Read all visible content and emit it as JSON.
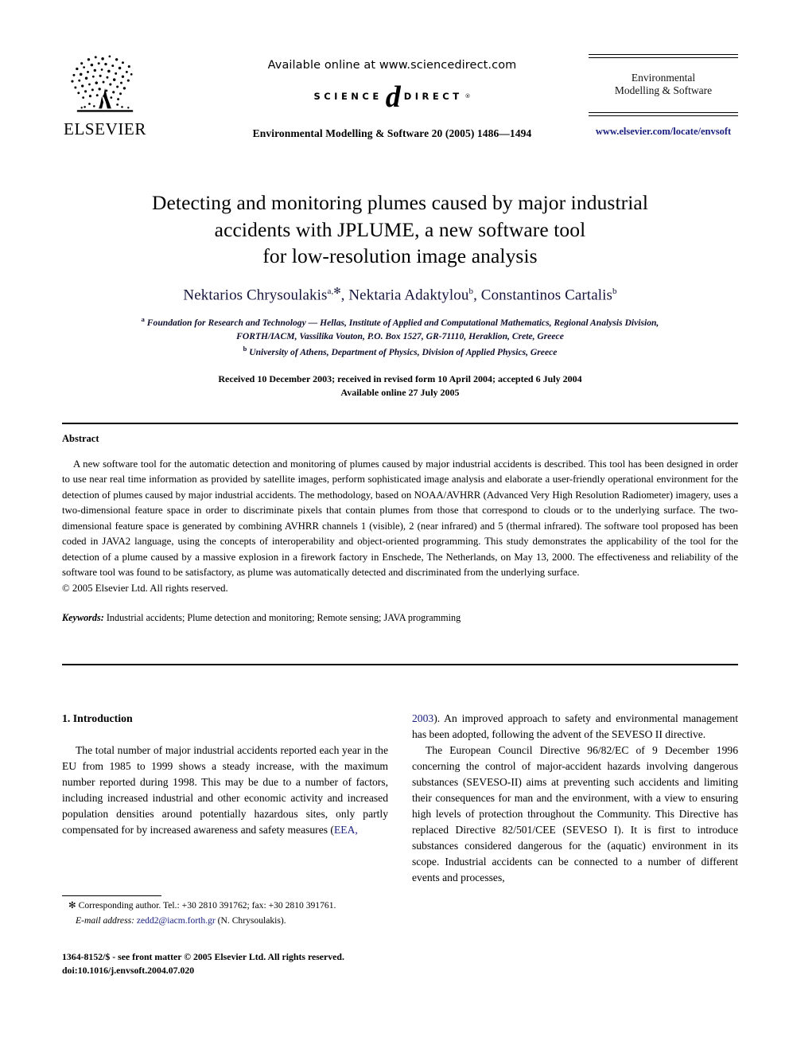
{
  "masthead": {
    "publisher_name": "ELSEVIER",
    "available_online": "Available online at www.sciencedirect.com",
    "sciencedirect": {
      "word_left": "SCIENCE",
      "at_glyph": "d",
      "word_right": "DIRECT",
      "trademark": "®"
    },
    "journal_reference": "Environmental Modelling & Software 20 (2005) 1486—1494",
    "journal_name_line1": "Environmental",
    "journal_name_line2": "Modelling & Software",
    "journal_url": "www.elsevier.com/locate/envsoft"
  },
  "article": {
    "title_line1": "Detecting and monitoring plumes caused by major industrial",
    "title_line2": "accidents with JPLUME, a new software tool",
    "title_line3": "for low-resolution image analysis",
    "authors": [
      {
        "name": "Nektarios Chrysoulakis",
        "marks": "a,✻"
      },
      {
        "name": "Nektaria Adaktylou",
        "marks": "b"
      },
      {
        "name": "Constantinos Cartalis",
        "marks": "b"
      }
    ],
    "affiliation_a_line1": "Foundation for Research and Technology — Hellas, Institute of Applied and Computational Mathematics, Regional Analysis Division,",
    "affiliation_a_line2": "FORTH/IACM, Vassilika Vouton, P.O. Box 1527, GR-71110, Heraklion, Crete, Greece",
    "affiliation_b": "University of Athens, Department of Physics, Division of Applied Physics, Greece",
    "affiliation_a_mark": "a",
    "affiliation_b_mark": "b",
    "received_line": "Received 10 December 2003; received in revised form 10 April 2004; accepted 6 July 2004",
    "available_line": "Available online 27 July 2005"
  },
  "abstract": {
    "heading": "Abstract",
    "text": "A new software tool for the automatic detection and monitoring of plumes caused by major industrial accidents is described. This tool has been designed in order to use near real time information as provided by satellite images, perform sophisticated image analysis and elaborate a user-friendly operational environment for the detection of plumes caused by major industrial accidents. The methodology, based on NOAA/AVHRR (Advanced Very High Resolution Radiometer) imagery, uses a two-dimensional feature space in order to discriminate pixels that contain plumes from those that correspond to clouds or to the underlying surface. The two-dimensional feature space is generated by combining AVHRR channels 1 (visible), 2 (near infrared) and 5 (thermal infrared). The software tool proposed has been coded in JAVA2 language, using the concepts of interoperability and object-oriented programming. This study demonstrates the applicability of the tool for the detection of a plume caused by a massive explosion in a firework factory in Enschede, The Netherlands, on May 13, 2000. The effectiveness and reliability of the software tool was found to be satisfactory, as plume was automatically detected and discriminated from the underlying surface.",
    "copyright": "© 2005 Elsevier Ltd. All rights reserved.",
    "keywords_label": "Keywords:",
    "keywords_text": "Industrial accidents; Plume detection and monitoring; Remote sensing; JAVA programming"
  },
  "body": {
    "section_heading": "1. Introduction",
    "left_paragraph_1_part1": "The total number of major industrial accidents reported each year in the EU from 1985 to 1999 shows a steady increase, with the maximum number reported during 1998. This may be due to a number of factors, including increased industrial and other economic activity and increased population densities around potentially hazardous sites, only partly compensated for by increased awareness and safety measures (",
    "citation_eea": "EEA, 2003",
    "right_paragraph_1_part2": "). An improved approach to safety and environmental management has been adopted, following the advent of the SEVESO II directive.",
    "right_paragraph_2": "The European Council Directive 96/82/EC of 9 December 1996 concerning the control of major-accident hazards involving dangerous substances (SEVESO-II) aims at preventing such accidents and limiting their consequences for man and the environment, with a view to ensuring high levels of protection throughout the Community. This Directive has replaced Directive 82/501/CEE (SEVESO I). It is first to introduce substances considered dangerous for the (aquatic) environment in its scope. Industrial accidents can be connected to a number of different events and processes,"
  },
  "footnotes": {
    "corresponding_marker": "✻",
    "corresponding_text": "Corresponding author. Tel.: +30 2810 391762; fax: +30 2810 391761.",
    "email_label": "E-mail address:",
    "email_address": "zedd2@iacm.forth.gr",
    "email_owner": "(N. Chrysoulakis).",
    "imprint_line1": "1364-8152/$ - see front matter © 2005 Elsevier Ltd. All rights reserved.",
    "imprint_line2": "doi:10.1016/j.envsoft.2004.07.020"
  },
  "colors": {
    "link": "#1a2080",
    "author": "#14143c",
    "text": "#000000",
    "background": "#ffffff"
  }
}
